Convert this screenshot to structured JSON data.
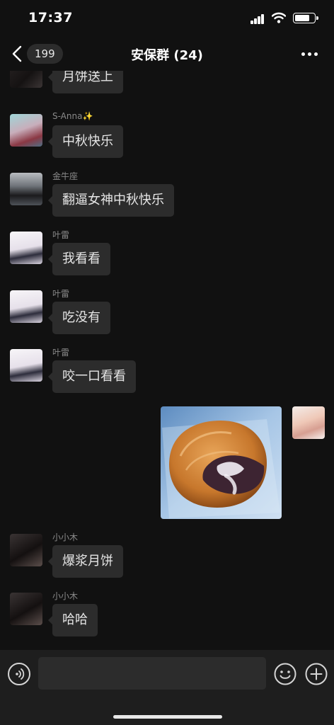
{
  "status_bar": {
    "time": "17:37"
  },
  "nav": {
    "back_count": "199",
    "title": "安保群 (24)"
  },
  "messages": [
    {
      "text": "月饼送上"
    },
    {
      "sender": "S-Anna✨",
      "text": "中秋快乐"
    },
    {
      "sender": "金牛座",
      "text": "翻逼女神中秋快乐"
    },
    {
      "sender": "叶雷",
      "text": "我看看"
    },
    {
      "sender": "叶雷",
      "text": "吃没有"
    },
    {
      "sender": "叶雷",
      "text": "咬一口看看"
    },
    {
      "sender": "小小木",
      "text": "爆浆月饼"
    },
    {
      "sender": "小小木",
      "text": "哈哈"
    }
  ],
  "input": {
    "value": "",
    "placeholder": ""
  },
  "icons": {
    "back": "chevron-left-icon",
    "more": "more-dots-icon",
    "voice": "voice-icon",
    "emoji": "emoji-icon",
    "plus": "plus-icon"
  },
  "colors": {
    "background": "#111111",
    "bubble": "#2c2c2c",
    "input_bar": "#1e1e1e",
    "sender_name": "#8a8a8a"
  }
}
